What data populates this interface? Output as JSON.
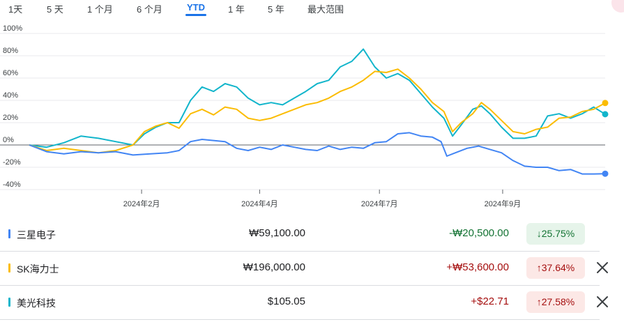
{
  "range_tabs": [
    {
      "id": "1d",
      "label": "1天"
    },
    {
      "id": "5d",
      "label": "5 天"
    },
    {
      "id": "1m",
      "label": "1 个月"
    },
    {
      "id": "6m",
      "label": "6 个月"
    },
    {
      "id": "ytd",
      "label": "YTD",
      "active": true
    },
    {
      "id": "1y",
      "label": "1 年"
    },
    {
      "id": "5y",
      "label": "5 年"
    },
    {
      "id": "max",
      "label": "最大范围"
    }
  ],
  "chart_data": {
    "type": "line",
    "x_ticks": [
      "2024年2月",
      "2024年4月",
      "2024年7月",
      "2024年9月"
    ],
    "y_ticks": [
      "100%",
      "80%",
      "60%",
      "40%",
      "20%",
      "0%",
      "-20%",
      "-40%"
    ],
    "y_unit": "% change",
    "ylim": [
      -40,
      100
    ],
    "x_domain": [
      0,
      100
    ],
    "x_tick_positions": [
      19.5,
      40.0,
      60.8,
      82.2
    ],
    "grid": true,
    "zero_line": true,
    "series": [
      {
        "name": "三星电子",
        "color": "#4285f4",
        "points": [
          [
            0,
            0
          ],
          [
            3,
            -6
          ],
          [
            6,
            -8
          ],
          [
            9,
            -6
          ],
          [
            12,
            -7
          ],
          [
            15,
            -6
          ],
          [
            18,
            -9
          ],
          [
            21,
            -8
          ],
          [
            24,
            -7
          ],
          [
            26,
            -5
          ],
          [
            28,
            3
          ],
          [
            30,
            5
          ],
          [
            32,
            4
          ],
          [
            34,
            3
          ],
          [
            36,
            -3
          ],
          [
            38,
            -5
          ],
          [
            40,
            -2
          ],
          [
            42,
            -4
          ],
          [
            44,
            0
          ],
          [
            46,
            -2
          ],
          [
            48,
            -4
          ],
          [
            50,
            -5
          ],
          [
            52,
            -1
          ],
          [
            54,
            -4
          ],
          [
            56,
            -2
          ],
          [
            58,
            -3
          ],
          [
            60,
            2
          ],
          [
            62,
            3
          ],
          [
            64,
            10
          ],
          [
            66,
            11
          ],
          [
            68,
            8
          ],
          [
            70,
            7
          ],
          [
            71.5,
            3
          ],
          [
            72.5,
            -10
          ],
          [
            74,
            -7
          ],
          [
            76,
            -3
          ],
          [
            78,
            -1
          ],
          [
            80,
            -4
          ],
          [
            82,
            -7
          ],
          [
            84,
            -14
          ],
          [
            86,
            -19
          ],
          [
            88,
            -20
          ],
          [
            90,
            -20
          ],
          [
            92,
            -23
          ],
          [
            94,
            -22
          ],
          [
            96,
            -26
          ],
          [
            98,
            -26
          ],
          [
            100,
            -25.75
          ]
        ]
      },
      {
        "name": "SK海力士",
        "color": "#fbbc04",
        "points": [
          [
            0,
            0
          ],
          [
            3,
            -5
          ],
          [
            6,
            -3
          ],
          [
            9,
            -5
          ],
          [
            12,
            -7
          ],
          [
            15,
            -5
          ],
          [
            18,
            0
          ],
          [
            20,
            12
          ],
          [
            22,
            17
          ],
          [
            24,
            20
          ],
          [
            26,
            15
          ],
          [
            28,
            28
          ],
          [
            30,
            32
          ],
          [
            32,
            27
          ],
          [
            34,
            34
          ],
          [
            36,
            32
          ],
          [
            38,
            24
          ],
          [
            40,
            22
          ],
          [
            42,
            24
          ],
          [
            44,
            28
          ],
          [
            46,
            32
          ],
          [
            48,
            36
          ],
          [
            50,
            38
          ],
          [
            52,
            42
          ],
          [
            54,
            48
          ],
          [
            56,
            52
          ],
          [
            58,
            58
          ],
          [
            60,
            66
          ],
          [
            62,
            65
          ],
          [
            64,
            68
          ],
          [
            66,
            60
          ],
          [
            68,
            50
          ],
          [
            70,
            38
          ],
          [
            72,
            30
          ],
          [
            73.5,
            12
          ],
          [
            75,
            20
          ],
          [
            77,
            28
          ],
          [
            78.5,
            38
          ],
          [
            80,
            32
          ],
          [
            82,
            22
          ],
          [
            84,
            12
          ],
          [
            86,
            10
          ],
          [
            88,
            14
          ],
          [
            90,
            16
          ],
          [
            92,
            24
          ],
          [
            94,
            25
          ],
          [
            96,
            30
          ],
          [
            98,
            32
          ],
          [
            100,
            37.64
          ]
        ]
      },
      {
        "name": "美光科技",
        "color": "#12b5cb",
        "points": [
          [
            0,
            0
          ],
          [
            3,
            -2
          ],
          [
            6,
            2
          ],
          [
            9,
            8
          ],
          [
            12,
            6
          ],
          [
            15,
            3
          ],
          [
            18,
            0
          ],
          [
            20,
            10
          ],
          [
            22,
            16
          ],
          [
            24,
            20
          ],
          [
            26,
            20
          ],
          [
            28,
            40
          ],
          [
            30,
            52
          ],
          [
            32,
            48
          ],
          [
            34,
            55
          ],
          [
            36,
            52
          ],
          [
            38,
            42
          ],
          [
            40,
            36
          ],
          [
            42,
            38
          ],
          [
            44,
            36
          ],
          [
            46,
            42
          ],
          [
            48,
            48
          ],
          [
            50,
            55
          ],
          [
            52,
            58
          ],
          [
            54,
            70
          ],
          [
            56,
            75
          ],
          [
            58,
            86
          ],
          [
            60,
            70
          ],
          [
            62,
            60
          ],
          [
            64,
            64
          ],
          [
            66,
            58
          ],
          [
            68,
            46
          ],
          [
            70,
            34
          ],
          [
            72,
            24
          ],
          [
            73.5,
            8
          ],
          [
            75,
            18
          ],
          [
            77,
            32
          ],
          [
            78.5,
            35
          ],
          [
            80,
            28
          ],
          [
            82,
            16
          ],
          [
            84,
            6
          ],
          [
            86,
            6
          ],
          [
            88,
            8
          ],
          [
            90,
            26
          ],
          [
            92,
            28
          ],
          [
            94,
            24
          ],
          [
            96,
            28
          ],
          [
            98,
            34
          ],
          [
            100,
            27.58
          ]
        ]
      }
    ]
  },
  "quotes": [
    {
      "name": "三星电子",
      "color": "#4285f4",
      "price": "₩59,100.00",
      "change": "-₩20,500.00",
      "change_color": "#137333",
      "pct": "25.75%",
      "direction": "down",
      "removable": false
    },
    {
      "name": "SK海力士",
      "color": "#fbbc04",
      "price": "₩196,000.00",
      "change": "+₩53,600.00",
      "change_color": "#a50e0e",
      "pct": "37.64%",
      "direction": "up",
      "removable": true
    },
    {
      "name": "美光科技",
      "color": "#12b5cb",
      "price": "$105.05",
      "change": "+$22.71",
      "change_color": "#a50e0e",
      "pct": "27.58%",
      "direction": "up",
      "removable": true
    }
  ]
}
